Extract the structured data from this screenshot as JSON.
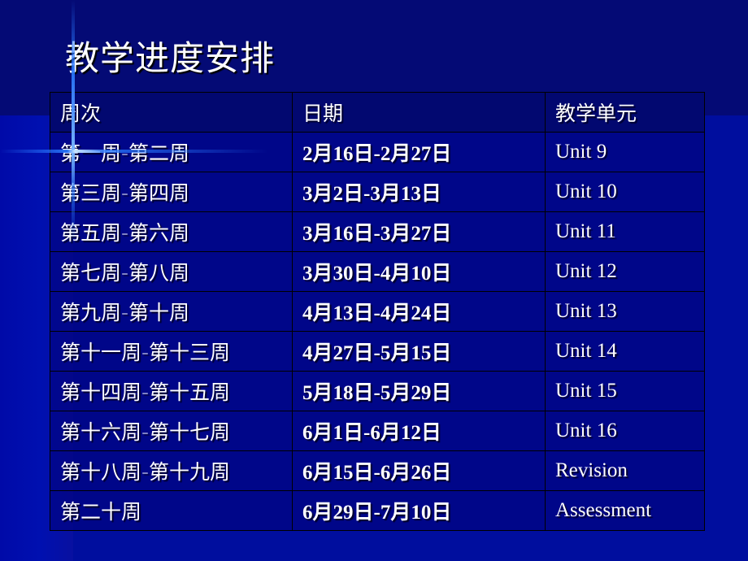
{
  "slide": {
    "title": "教学进度安排",
    "colors": {
      "background": "#000e9e",
      "top_band": "#040a75",
      "text": "#ffffff",
      "grid": "#000000"
    }
  },
  "table": {
    "headers": [
      "周次",
      "日期",
      "教学单元"
    ],
    "rows": [
      {
        "weeks": "第一周-第二周",
        "dates": "2月16日-2月27日",
        "unit": "Unit 9"
      },
      {
        "weeks": "第三周-第四周",
        "dates": "3月2日-3月13日",
        "unit": "Unit 10"
      },
      {
        "weeks": "第五周-第六周",
        "dates": "3月16日-3月27日",
        "unit": "Unit 11"
      },
      {
        "weeks": "第七周-第八周",
        "dates": "3月30日-4月10日",
        "unit": "Unit 12"
      },
      {
        "weeks": "第九周-第十周",
        "dates": "4月13日-4月24日",
        "unit": "Unit 13"
      },
      {
        "weeks": "第十一周-第十三周",
        "dates": "4月27日-5月15日",
        "unit": "Unit 14"
      },
      {
        "weeks": "第十四周-第十五周",
        "dates": "5月18日-5月29日",
        "unit": "Unit 15"
      },
      {
        "weeks": "第十六周-第十七周",
        "dates": "6月1日-6月12日",
        "unit": "Unit 16"
      },
      {
        "weeks": "第十八周-第十九周",
        "dates": "6月15日-6月26日",
        "unit": "Revision"
      },
      {
        "weeks": "第二十周",
        "dates": "6月29日-7月10日",
        "unit": "Assessment"
      }
    ]
  }
}
